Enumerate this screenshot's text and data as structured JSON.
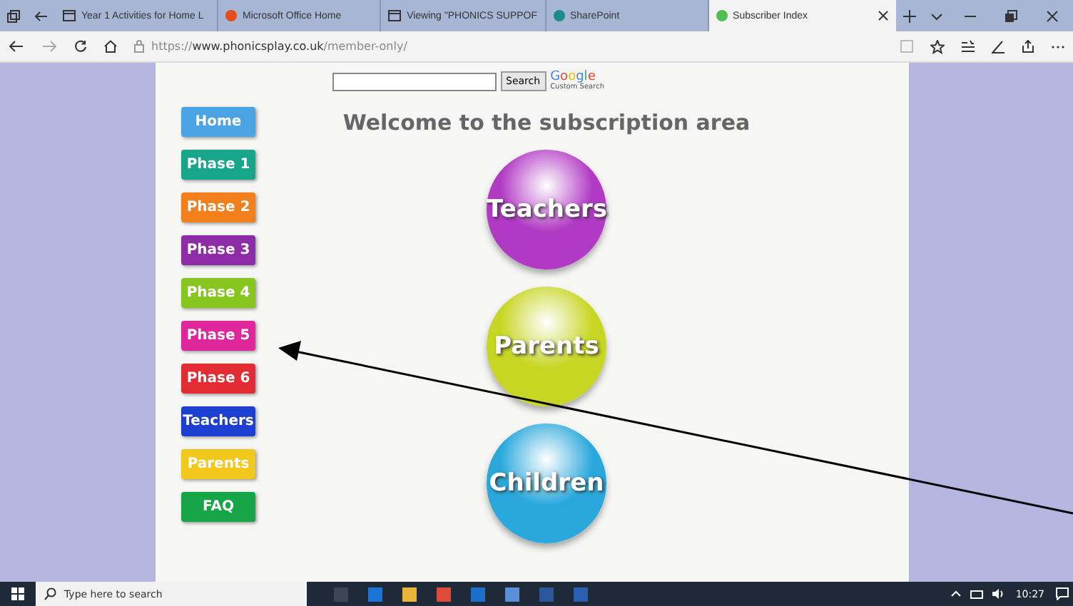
{
  "browser": {
    "tabs": [
      {
        "label": "Year 1 Activities for Home L",
        "kind": "page",
        "selected": false
      },
      {
        "label": "Microsoft Office Home",
        "kind": "site",
        "color": "#e74c1c",
        "selected": false
      },
      {
        "label": "Viewing \"PHONICS SUPPOF",
        "kind": "page",
        "selected": false
      },
      {
        "label": "SharePoint",
        "kind": "site",
        "color": "#1a8b8b",
        "selected": false
      },
      {
        "label": "Subscriber Index",
        "kind": "site",
        "color": "#4fc04f",
        "selected": true
      }
    ],
    "address": "https://**www.phonicsplay.co.uk**/member-only/"
  },
  "search": {
    "button": "Search",
    "brand": "Google",
    "brand_caption": "Custom Search"
  },
  "nav": [
    {
      "label": "Home",
      "color": "#4aa3e2"
    },
    {
      "label": "Phase 1",
      "color": "#17a68c"
    },
    {
      "label": "Phase 2",
      "color": "#f27e1c"
    },
    {
      "label": "Phase 3",
      "color": "#8e2ca8"
    },
    {
      "label": "Phase 4",
      "color": "#86c61f"
    },
    {
      "label": "Phase 5",
      "color": "#e0269b"
    },
    {
      "label": "Phase 6",
      "color": "#e22b32"
    },
    {
      "label": "Teachers",
      "color": "#1c3fd2"
    },
    {
      "label": "Parents",
      "color": "#f2c81c"
    },
    {
      "label": "FAQ",
      "color": "#17a647"
    }
  ],
  "heading": "Welcome to the subscription area",
  "areas": [
    {
      "label": "Teachers",
      "color": "#b13ac4"
    },
    {
      "label": "Parents",
      "color": "#c7d622"
    },
    {
      "label": "Children",
      "color": "#2aa8dc"
    }
  ],
  "taskbar": {
    "search_placeholder": "Type here to search",
    "time": "10:27"
  }
}
